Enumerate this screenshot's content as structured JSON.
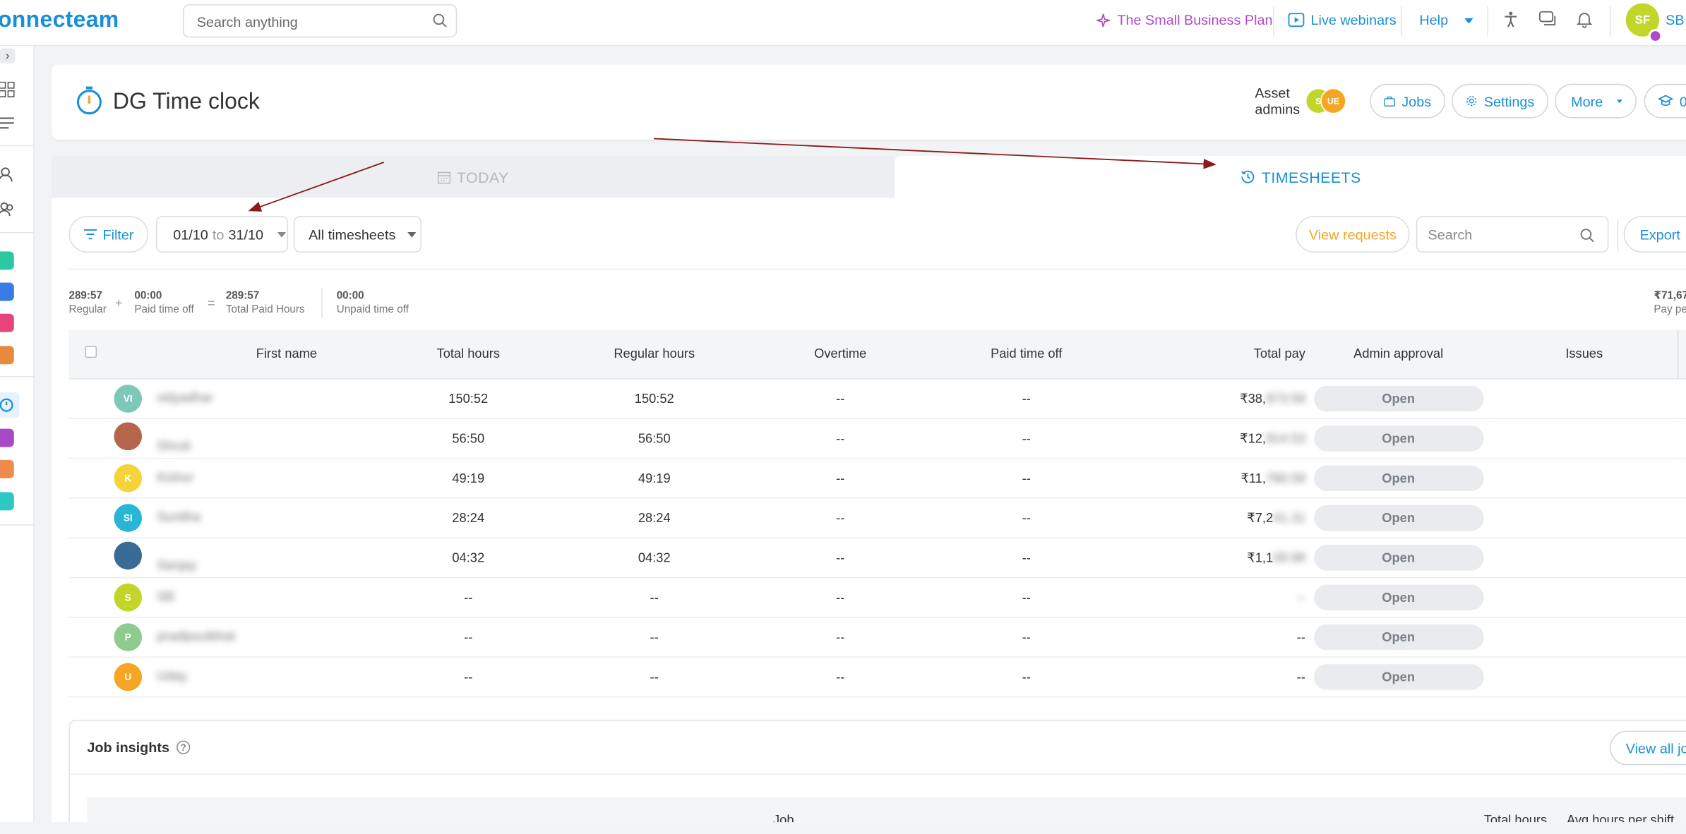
{
  "app": {
    "logo_text": "onnecteam"
  },
  "topbar": {
    "search_placeholder": "Search anything",
    "plan_label": "The Small Business Plan",
    "webinars_label": "Live webinars",
    "help_label": "Help",
    "user_initials": "SF",
    "user_short": "SB",
    "colors": {
      "plan": "#b04ac6",
      "link": "#1a8fd8"
    }
  },
  "header": {
    "title": "DG Time clock",
    "asset_admins_label_1": "Asset",
    "asset_admins_label_2": "admins",
    "admin_avatars": [
      {
        "initials": "S",
        "color": "#c2d62a"
      },
      {
        "initials": "UE",
        "color": "#f5a623"
      }
    ],
    "buttons": {
      "jobs": "Jobs",
      "settings": "Settings",
      "more": "More",
      "partial": "0"
    }
  },
  "tabs": {
    "today": "TODAY",
    "timesheets": "TIMESHEETS"
  },
  "toolbar": {
    "filter": "Filter",
    "date_from": "01/10",
    "date_to_word": "to",
    "date_to": "31/10",
    "timesheet_select": "All timesheets",
    "view_requests": "View requests",
    "search_placeholder": "Search",
    "export": "Export"
  },
  "summary": {
    "regular_value": "289:57",
    "regular_label": "Regular",
    "pto_value": "00:00",
    "pto_label": "Paid time off",
    "total_value": "289:57",
    "total_label": "Total Paid Hours",
    "unpaid_value": "00:00",
    "unpaid_label": "Unpaid time off",
    "pay_value": "₹71,67",
    "pay_label": "Pay pe"
  },
  "table": {
    "columns": [
      "First name",
      "Total hours",
      "Regular hours",
      "Overtime",
      "Paid time off",
      "Total pay",
      "Admin approval",
      "Issues"
    ],
    "rows": [
      {
        "initials": "VI",
        "color": "#7ec8b8",
        "name": "vidyadhar",
        "total": "150:52",
        "regular": "150:52",
        "overtime": "--",
        "pto": "--",
        "pay_visible": "₹38,",
        "pay_hidden": "973.59",
        "approval": "Open"
      },
      {
        "initials": "",
        "color": "#b5654a",
        "name": "Shruti",
        "total": "56:50",
        "regular": "56:50",
        "overtime": "--",
        "pto": "--",
        "pay_visible": "₹12,",
        "pay_hidden": "914.53",
        "approval": "Open"
      },
      {
        "initials": "K",
        "color": "#f5d33a",
        "name": "Kishor",
        "total": "49:19",
        "regular": "49:19",
        "overtime": "--",
        "pto": "--",
        "pay_visible": "₹11,",
        "pay_hidden": "780.59",
        "approval": "Open"
      },
      {
        "initials": "SI",
        "color": "#29b6d6",
        "name": "Sunitha",
        "total": "28:24",
        "regular": "28:24",
        "overtime": "--",
        "pto": "--",
        "pay_visible": "₹7,2",
        "pay_hidden": "41.31",
        "approval": "Open"
      },
      {
        "initials": "",
        "color": "#3a6b96",
        "name": "Sanjay",
        "total": "04:32",
        "regular": "04:32",
        "overtime": "--",
        "pto": "--",
        "pay_visible": "₹1,1",
        "pay_hidden": "09.98",
        "approval": "Open"
      },
      {
        "initials": "S",
        "color": "#c2d62a",
        "name": "SB",
        "total": "--",
        "regular": "--",
        "overtime": "--",
        "pto": "--",
        "pay_visible": "",
        "pay_hidden": "--",
        "approval": "Open"
      },
      {
        "initials": "P",
        "color": "#8fcb8f",
        "name": "pradipsutbhat",
        "total": "--",
        "regular": "--",
        "overtime": "--",
        "pto": "--",
        "pay_visible": "--",
        "pay_hidden": "",
        "approval": "Open"
      },
      {
        "initials": "U",
        "color": "#f5a623",
        "name": "Uday",
        "total": "--",
        "regular": "--",
        "overtime": "--",
        "pto": "--",
        "pay_visible": "--",
        "pay_hidden": "",
        "approval": "Open"
      }
    ]
  },
  "job_insights": {
    "title": "Job insights",
    "view_all": "View all job",
    "col_job": "Job",
    "col_total_hours": "Total hours",
    "col_avg_hours": "Avg hours per shift"
  }
}
